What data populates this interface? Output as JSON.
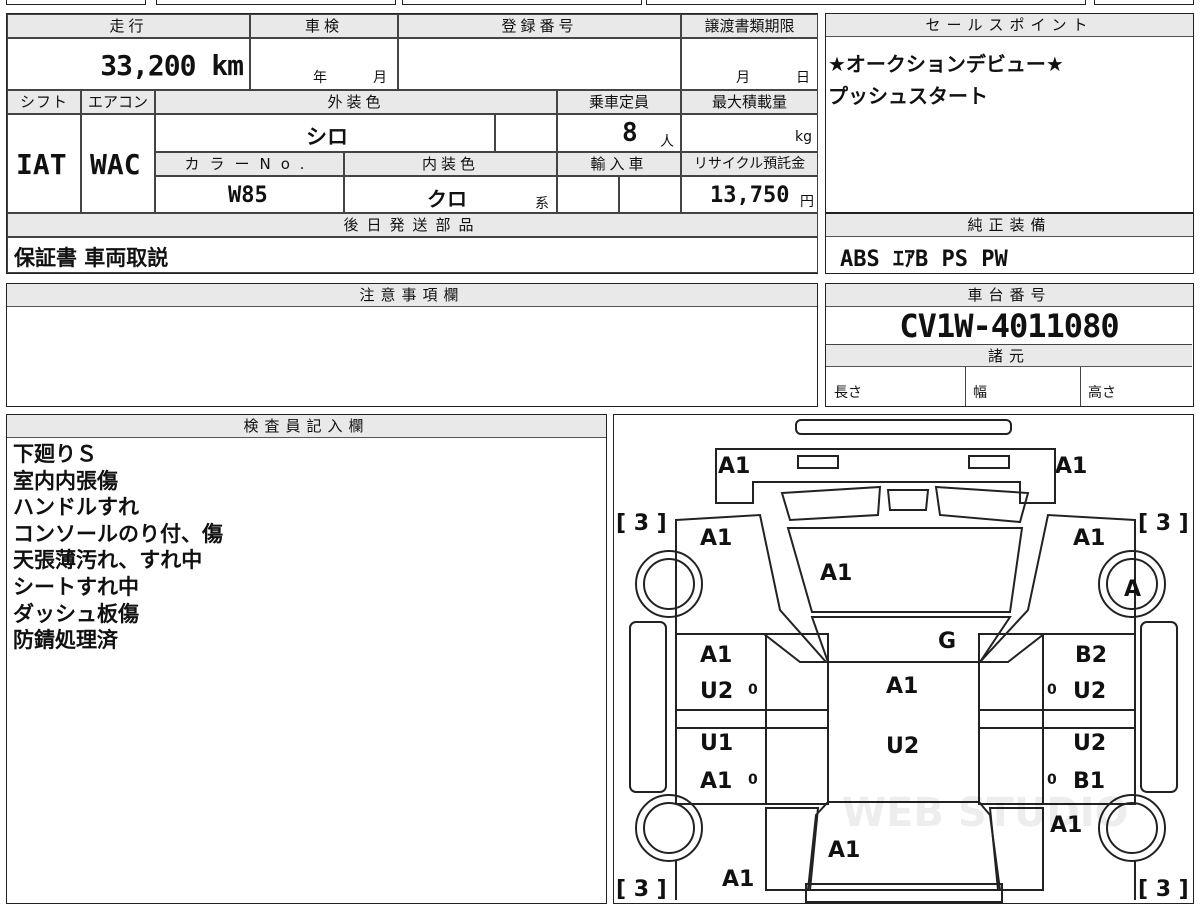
{
  "summary": {
    "mileage_label": "走行",
    "mileage_value": "33,200 km",
    "inspection_label": "車検",
    "inspection_year": "年",
    "inspection_month": "月",
    "registration_label": "登録番号",
    "registration_value": "",
    "transfer_label": "譲渡書類期限",
    "transfer_month": "月",
    "transfer_day": "日",
    "shift_label": "シフト",
    "shift_value": "IAT",
    "aircon_label": "エアコン",
    "aircon_value": "WAC",
    "exterior_color_label": "外装色",
    "exterior_color_value": "シロ",
    "capacity_label": "乗車定員",
    "capacity_value": "8",
    "capacity_unit": "人",
    "max_load_label": "最大積載量",
    "max_load_unit": "kg",
    "color_no_label": "カラーNo.",
    "color_no_value": "W85",
    "interior_color_label": "内装色",
    "interior_color_value": "クロ",
    "interior_color_unit": "系",
    "import_label": "輸入車",
    "recycle_label": "リサイクル預託金",
    "recycle_value": "13,750",
    "recycle_unit": "円",
    "later_parts_label": "後日発送部品",
    "later_parts_value": "保証書 車両取説"
  },
  "sales_point": {
    "label": "セールスポイント",
    "lines": [
      "★オークションデビュー★",
      "プッシュスタート"
    ]
  },
  "standard_equipment": {
    "label": "純正装備",
    "value": "ABS ｴｱB PS PW"
  },
  "caution": {
    "label": "注意事項欄",
    "value": ""
  },
  "chassis": {
    "label": "車台番号",
    "value": "CV1W-4011080",
    "spec_label": "諸元",
    "length_label": "長さ",
    "width_label": "幅",
    "height_label": "高さ"
  },
  "inspector": {
    "label": "検査員記入欄",
    "notes": [
      "下廻りＳ",
      "室内内張傷",
      "ハンドルすれ",
      "コンソールのり付、傷",
      "天張薄汚れ、すれ中",
      "シートすれ中",
      "ダッシュ板傷",
      "防錆処理済"
    ]
  },
  "diagram": {
    "watermark": "WEB STUDIO",
    "tire_tread_fl": "[ 3 ]",
    "tire_tread_fr": "[ 3 ]",
    "tire_tread_rl": "[ 3 ]",
    "tire_tread_rr": "[ 3 ]",
    "marks": {
      "front_bumper_left": "A1",
      "front_bumper_right": "A1",
      "fender_front_left": "A1",
      "fender_front_right": "A1",
      "bonnet": "A1",
      "wheel_front_right": "A",
      "windshield": "G",
      "front_door_left_1": "A1",
      "front_door_left_2": "U2",
      "front_door_left_zero": "0",
      "front_door_right_1": "B2",
      "front_door_right_2": "U2",
      "front_door_right_zero": "0",
      "roof_1": "A1",
      "roof_2": "U2",
      "rear_door_left_1": "U1",
      "rear_door_left_2": "A1",
      "rear_door_left_zero": "0",
      "rear_door_right_1": "U2",
      "rear_door_right_2": "B1",
      "rear_door_right_zero": "0",
      "quarter_right": "A1",
      "back_door": "A1",
      "rear_bumper_left": "A1"
    }
  }
}
